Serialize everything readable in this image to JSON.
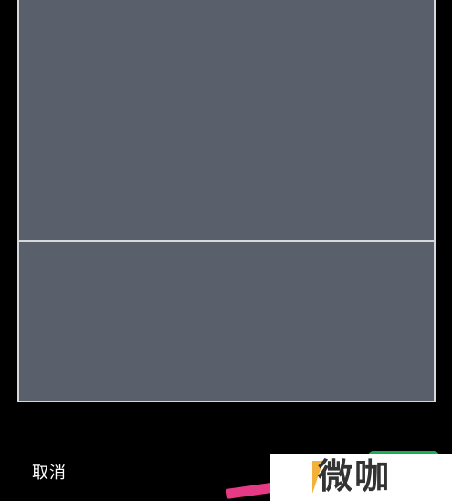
{
  "editor": {
    "cancel_label": "取消",
    "confirm_label": ""
  },
  "watermark": {
    "text": "微咖"
  },
  "colors": {
    "background": "#000000",
    "crop_area": "#59606c",
    "crop_border": "#d6d8dc",
    "confirm_button": "#1aad5a",
    "pink_stroke": "#e63a84",
    "watermark_accent": "#f2b138"
  }
}
